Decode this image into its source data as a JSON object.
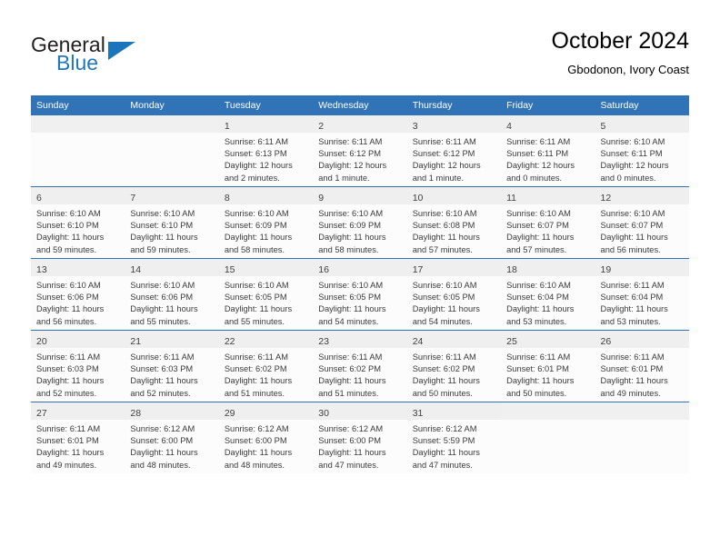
{
  "brand": {
    "name_part1": "General",
    "name_part2": "Blue",
    "triangle_color": "#1c75bc",
    "blue_text_color": "#2077bc"
  },
  "header": {
    "title": "October 2024",
    "subtitle": "Gbodonon, Ivory Coast"
  },
  "theme": {
    "header_blue": "#3073b6",
    "daynum_band": "#efefef",
    "cell_bg": "#fcfcfc",
    "text": "#3a3a3a"
  },
  "weekdays": [
    "Sunday",
    "Monday",
    "Tuesday",
    "Wednesday",
    "Thursday",
    "Friday",
    "Saturday"
  ],
  "weeks": [
    [
      {
        "day": "",
        "sunrise": "",
        "sunset": "",
        "daylight1": "",
        "daylight2": ""
      },
      {
        "day": "",
        "sunrise": "",
        "sunset": "",
        "daylight1": "",
        "daylight2": ""
      },
      {
        "day": "1",
        "sunrise": "Sunrise: 6:11 AM",
        "sunset": "Sunset: 6:13 PM",
        "daylight1": "Daylight: 12 hours",
        "daylight2": "and 2 minutes."
      },
      {
        "day": "2",
        "sunrise": "Sunrise: 6:11 AM",
        "sunset": "Sunset: 6:12 PM",
        "daylight1": "Daylight: 12 hours",
        "daylight2": "and 1 minute."
      },
      {
        "day": "3",
        "sunrise": "Sunrise: 6:11 AM",
        "sunset": "Sunset: 6:12 PM",
        "daylight1": "Daylight: 12 hours",
        "daylight2": "and 1 minute."
      },
      {
        "day": "4",
        "sunrise": "Sunrise: 6:11 AM",
        "sunset": "Sunset: 6:11 PM",
        "daylight1": "Daylight: 12 hours",
        "daylight2": "and 0 minutes."
      },
      {
        "day": "5",
        "sunrise": "Sunrise: 6:10 AM",
        "sunset": "Sunset: 6:11 PM",
        "daylight1": "Daylight: 12 hours",
        "daylight2": "and 0 minutes."
      }
    ],
    [
      {
        "day": "6",
        "sunrise": "Sunrise: 6:10 AM",
        "sunset": "Sunset: 6:10 PM",
        "daylight1": "Daylight: 11 hours",
        "daylight2": "and 59 minutes."
      },
      {
        "day": "7",
        "sunrise": "Sunrise: 6:10 AM",
        "sunset": "Sunset: 6:10 PM",
        "daylight1": "Daylight: 11 hours",
        "daylight2": "and 59 minutes."
      },
      {
        "day": "8",
        "sunrise": "Sunrise: 6:10 AM",
        "sunset": "Sunset: 6:09 PM",
        "daylight1": "Daylight: 11 hours",
        "daylight2": "and 58 minutes."
      },
      {
        "day": "9",
        "sunrise": "Sunrise: 6:10 AM",
        "sunset": "Sunset: 6:09 PM",
        "daylight1": "Daylight: 11 hours",
        "daylight2": "and 58 minutes."
      },
      {
        "day": "10",
        "sunrise": "Sunrise: 6:10 AM",
        "sunset": "Sunset: 6:08 PM",
        "daylight1": "Daylight: 11 hours",
        "daylight2": "and 57 minutes."
      },
      {
        "day": "11",
        "sunrise": "Sunrise: 6:10 AM",
        "sunset": "Sunset: 6:07 PM",
        "daylight1": "Daylight: 11 hours",
        "daylight2": "and 57 minutes."
      },
      {
        "day": "12",
        "sunrise": "Sunrise: 6:10 AM",
        "sunset": "Sunset: 6:07 PM",
        "daylight1": "Daylight: 11 hours",
        "daylight2": "and 56 minutes."
      }
    ],
    [
      {
        "day": "13",
        "sunrise": "Sunrise: 6:10 AM",
        "sunset": "Sunset: 6:06 PM",
        "daylight1": "Daylight: 11 hours",
        "daylight2": "and 56 minutes."
      },
      {
        "day": "14",
        "sunrise": "Sunrise: 6:10 AM",
        "sunset": "Sunset: 6:06 PM",
        "daylight1": "Daylight: 11 hours",
        "daylight2": "and 55 minutes."
      },
      {
        "day": "15",
        "sunrise": "Sunrise: 6:10 AM",
        "sunset": "Sunset: 6:05 PM",
        "daylight1": "Daylight: 11 hours",
        "daylight2": "and 55 minutes."
      },
      {
        "day": "16",
        "sunrise": "Sunrise: 6:10 AM",
        "sunset": "Sunset: 6:05 PM",
        "daylight1": "Daylight: 11 hours",
        "daylight2": "and 54 minutes."
      },
      {
        "day": "17",
        "sunrise": "Sunrise: 6:10 AM",
        "sunset": "Sunset: 6:05 PM",
        "daylight1": "Daylight: 11 hours",
        "daylight2": "and 54 minutes."
      },
      {
        "day": "18",
        "sunrise": "Sunrise: 6:10 AM",
        "sunset": "Sunset: 6:04 PM",
        "daylight1": "Daylight: 11 hours",
        "daylight2": "and 53 minutes."
      },
      {
        "day": "19",
        "sunrise": "Sunrise: 6:11 AM",
        "sunset": "Sunset: 6:04 PM",
        "daylight1": "Daylight: 11 hours",
        "daylight2": "and 53 minutes."
      }
    ],
    [
      {
        "day": "20",
        "sunrise": "Sunrise: 6:11 AM",
        "sunset": "Sunset: 6:03 PM",
        "daylight1": "Daylight: 11 hours",
        "daylight2": "and 52 minutes."
      },
      {
        "day": "21",
        "sunrise": "Sunrise: 6:11 AM",
        "sunset": "Sunset: 6:03 PM",
        "daylight1": "Daylight: 11 hours",
        "daylight2": "and 52 minutes."
      },
      {
        "day": "22",
        "sunrise": "Sunrise: 6:11 AM",
        "sunset": "Sunset: 6:02 PM",
        "daylight1": "Daylight: 11 hours",
        "daylight2": "and 51 minutes."
      },
      {
        "day": "23",
        "sunrise": "Sunrise: 6:11 AM",
        "sunset": "Sunset: 6:02 PM",
        "daylight1": "Daylight: 11 hours",
        "daylight2": "and 51 minutes."
      },
      {
        "day": "24",
        "sunrise": "Sunrise: 6:11 AM",
        "sunset": "Sunset: 6:02 PM",
        "daylight1": "Daylight: 11 hours",
        "daylight2": "and 50 minutes."
      },
      {
        "day": "25",
        "sunrise": "Sunrise: 6:11 AM",
        "sunset": "Sunset: 6:01 PM",
        "daylight1": "Daylight: 11 hours",
        "daylight2": "and 50 minutes."
      },
      {
        "day": "26",
        "sunrise": "Sunrise: 6:11 AM",
        "sunset": "Sunset: 6:01 PM",
        "daylight1": "Daylight: 11 hours",
        "daylight2": "and 49 minutes."
      }
    ],
    [
      {
        "day": "27",
        "sunrise": "Sunrise: 6:11 AM",
        "sunset": "Sunset: 6:01 PM",
        "daylight1": "Daylight: 11 hours",
        "daylight2": "and 49 minutes."
      },
      {
        "day": "28",
        "sunrise": "Sunrise: 6:12 AM",
        "sunset": "Sunset: 6:00 PM",
        "daylight1": "Daylight: 11 hours",
        "daylight2": "and 48 minutes."
      },
      {
        "day": "29",
        "sunrise": "Sunrise: 6:12 AM",
        "sunset": "Sunset: 6:00 PM",
        "daylight1": "Daylight: 11 hours",
        "daylight2": "and 48 minutes."
      },
      {
        "day": "30",
        "sunrise": "Sunrise: 6:12 AM",
        "sunset": "Sunset: 6:00 PM",
        "daylight1": "Daylight: 11 hours",
        "daylight2": "and 47 minutes."
      },
      {
        "day": "31",
        "sunrise": "Sunrise: 6:12 AM",
        "sunset": "Sunset: 5:59 PM",
        "daylight1": "Daylight: 11 hours",
        "daylight2": "and 47 minutes."
      },
      {
        "day": "",
        "sunrise": "",
        "sunset": "",
        "daylight1": "",
        "daylight2": ""
      },
      {
        "day": "",
        "sunrise": "",
        "sunset": "",
        "daylight1": "",
        "daylight2": ""
      }
    ]
  ]
}
